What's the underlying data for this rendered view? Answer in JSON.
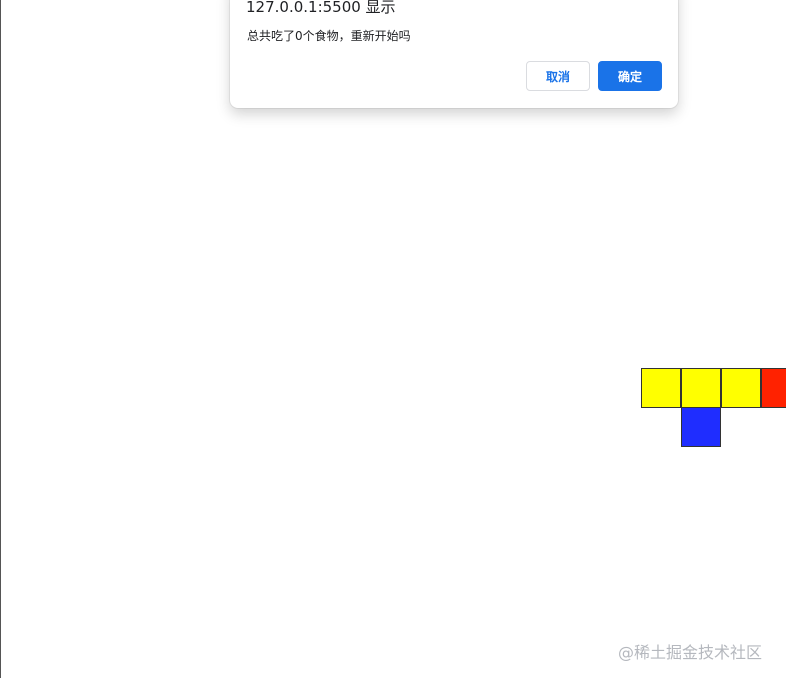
{
  "dialog": {
    "title": "127.0.0.1:5500 显示",
    "message": "总共吃了0个食物，重新开始吗",
    "cancel_label": "取消",
    "ok_label": "确定"
  },
  "game": {
    "snake_body_color": "#ffff00",
    "snake_head_color": "#ff2200",
    "food_color": "#1f2dff"
  },
  "watermark": "@稀土掘金技术社区"
}
